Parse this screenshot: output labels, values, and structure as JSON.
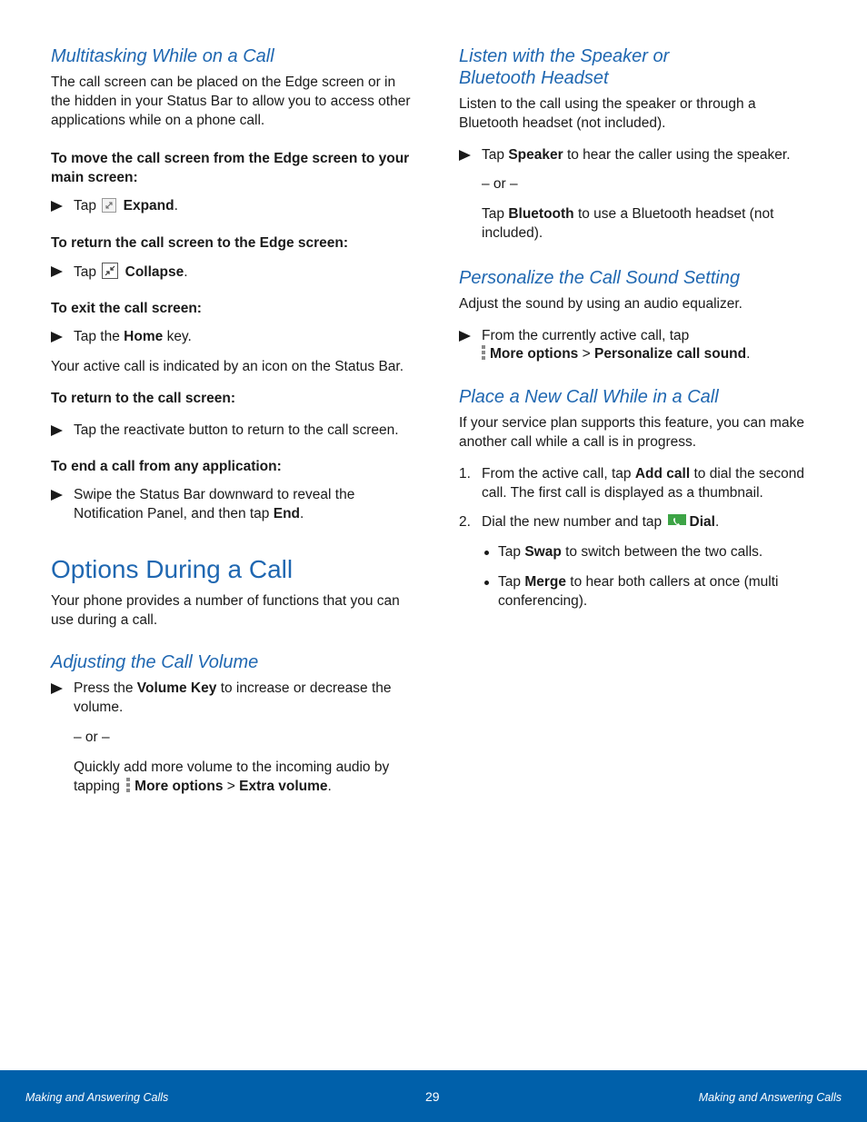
{
  "left": {
    "multitasking": {
      "heading": "Multitasking While on a Call",
      "intro": "The call screen can be placed on the Edge screen or in the hidden in your Status Bar to allow you to access other applications while on a phone call.",
      "move_label": "To move the call screen from the Edge screen to your main screen:",
      "move_step": {
        "pre": "Tap",
        "icon": "expand-icon",
        "bold": "Expand",
        "post": "."
      },
      "return_edge_label": "To return the call screen to the Edge screen:",
      "return_edge_step": {
        "pre": "Tap",
        "icon": "collapse-icon",
        "bold": "Collapse",
        "post": "."
      },
      "exit_label": "To exit the call screen:",
      "exit_step": {
        "pre": "Tap the",
        "bold": "Home",
        "post": "key."
      },
      "active_note": "Your active call is indicated by an icon on the Status Bar.",
      "return_call_label": "To return to the call screen:",
      "return_call_step": "Tap the reactivate button to return to the call screen.",
      "end_label": "To end a call from any application:",
      "end_step": {
        "pre": "Swipe the Status Bar downward to reveal the Notification Panel, and then tap",
        "bold": "End",
        "post": "."
      }
    },
    "options": {
      "heading": "Options During a Call",
      "intro": "Your phone provides a number of functions that you can use during a call."
    },
    "volume": {
      "heading": "Adjusting the Call Volume",
      "step": {
        "pre": "Press the",
        "bold": "Volume Key",
        "post": "to increase or decrease the volume."
      },
      "or": "– or –",
      "alt": {
        "pre": "Quickly add more volume to the incoming audio by tapping",
        "icon": "more-options-icon",
        "bold1": "More options",
        "sep": ">",
        "bold2": "Extra volume",
        "post": "."
      }
    }
  },
  "right": {
    "speaker": {
      "heading_line1": "Listen with the Speaker or",
      "heading_line2": "Bluetooth Headset",
      "intro": "Listen to the call using the speaker or through a Bluetooth headset (not included).",
      "step": {
        "pre": "Tap",
        "bold": "Speaker",
        "post": "to hear the caller using the speaker."
      },
      "or": "– or –",
      "alt": {
        "pre": "Tap",
        "bold": "Bluetooth",
        "post": "to use a Bluetooth headset (not included)."
      }
    },
    "sound": {
      "heading": "Personalize the Call Sound Setting",
      "intro": "Adjust the sound by using an audio equalizer.",
      "step": {
        "pre": "From the currently active call, tap",
        "icon": "more-options-icon",
        "bold1": "More options",
        "sep": ">",
        "bold2": "Personalize call sound",
        "post": "."
      }
    },
    "newcall": {
      "heading": "Place a New Call While in a Call",
      "intro": "If your service plan supports this feature, you can make another call while a call is in progress.",
      "steps": [
        {
          "num": "1.",
          "pre": "From the active call, tap",
          "bold": "Add call",
          "post": "to dial the second call. The first call is displayed as a thumbnail."
        },
        {
          "num": "2.",
          "pre": "Dial the new number and tap",
          "icon": "dial-icon",
          "bold": "Dial",
          "post": "."
        }
      ],
      "bullets": [
        {
          "pre": "Tap",
          "bold": "Swap",
          "post": "to switch between the two calls."
        },
        {
          "pre": "Tap",
          "bold": "Merge",
          "post": "to hear both callers at once (multi conferencing)."
        }
      ]
    }
  },
  "footer": {
    "left": "Making and Answering Calls",
    "page_number": "29",
    "right": "Making and Answering Calls"
  },
  "colors": {
    "heading": "#1f67b1",
    "footer_bg": "#0060aa",
    "dial_green": "#3da446"
  }
}
